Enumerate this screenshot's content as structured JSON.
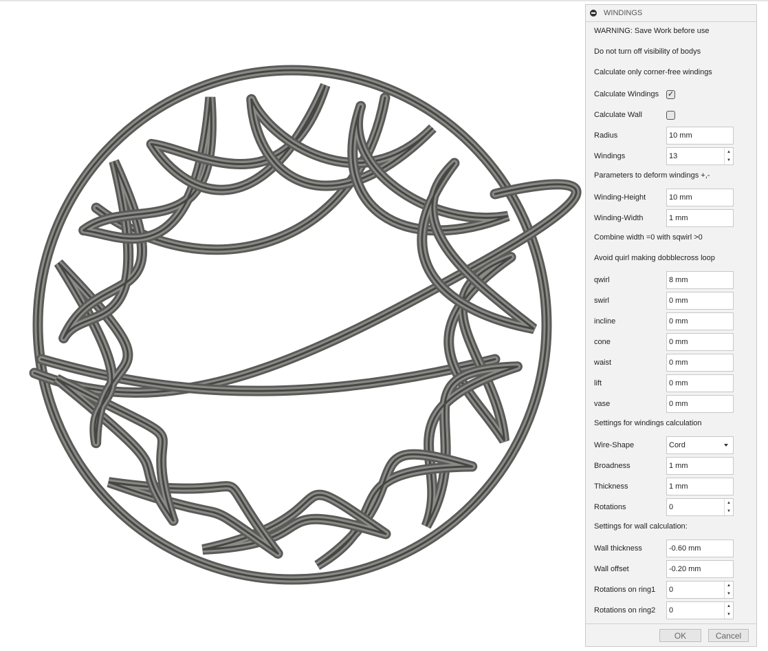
{
  "panel": {
    "title": "WINDINGS",
    "ok": "OK",
    "cancel": "Cancel"
  },
  "rows": [
    {
      "type": "text",
      "label": "WARNING: Save Work before use"
    },
    {
      "type": "text",
      "label": "Do not turn off visibility of bodys"
    },
    {
      "type": "text",
      "label": "Calculate only corner-free windings"
    },
    {
      "type": "check",
      "label": "Calculate Windings",
      "checked": true
    },
    {
      "type": "check",
      "label": "Calculate Wall",
      "checked": false
    },
    {
      "type": "input",
      "label": "Radius",
      "value": "10 mm"
    },
    {
      "type": "spin",
      "label": "Windings",
      "value": "13"
    },
    {
      "type": "text",
      "label": "Parameters to deform windings +,-"
    },
    {
      "type": "input",
      "label": "Winding-Height",
      "value": "10 mm"
    },
    {
      "type": "input",
      "label": "Winding-Width",
      "value": "1 mm"
    },
    {
      "type": "text",
      "label": "Combine width =0 with sqwirl >0"
    },
    {
      "type": "text",
      "label": "Avoid quirl making dobblecross loop"
    },
    {
      "type": "input",
      "label": "qwirl",
      "value": "8 mm"
    },
    {
      "type": "input",
      "label": "swirl",
      "value": "0 mm"
    },
    {
      "type": "input",
      "label": "incline",
      "value": "0 mm"
    },
    {
      "type": "input",
      "label": "cone",
      "value": "0 mm"
    },
    {
      "type": "input",
      "label": "waist",
      "value": "0 mm"
    },
    {
      "type": "input",
      "label": "lift",
      "value": "0 mm"
    },
    {
      "type": "input",
      "label": "vase",
      "value": "0 mm"
    },
    {
      "type": "text",
      "label": "Settings for windings calculation"
    },
    {
      "type": "select",
      "label": "Wire-Shape",
      "value": "Cord"
    },
    {
      "type": "input",
      "label": "Broadness",
      "value": "1 mm"
    },
    {
      "type": "input",
      "label": "Thickness",
      "value": "1 mm"
    },
    {
      "type": "spin",
      "label": "Rotations",
      "value": "0"
    },
    {
      "type": "text",
      "label": "Settings for wall calculation:"
    },
    {
      "type": "input",
      "label": "Wall thickness",
      "value": "-0.60 mm"
    },
    {
      "type": "input",
      "label": "Wall offset",
      "value": "-0.20 mm"
    },
    {
      "type": "spin",
      "label": "Rotations on ring1",
      "value": "0"
    },
    {
      "type": "spin",
      "label": "Rotations on ring2",
      "value": "0"
    }
  ]
}
